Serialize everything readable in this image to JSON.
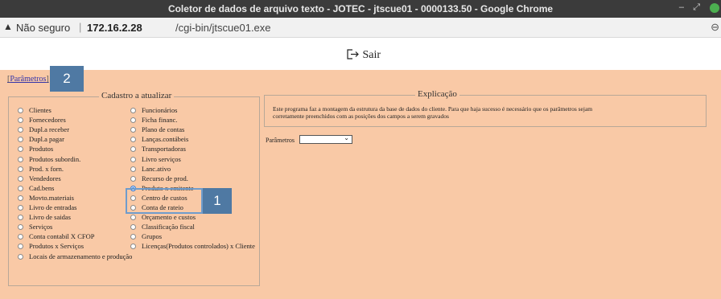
{
  "window": {
    "title": "Coletor de dados de arquivo texto - JOTEC - jtscue01 - 0000133.50 - Google Chrome",
    "controls": [
      "–",
      "⤢"
    ]
  },
  "address_bar": {
    "security_label": "Não seguro",
    "host": "172.16.2.28",
    "path": "/cgi-bin/jtscue01.exe"
  },
  "toolbar": {
    "exit_label": "Sair"
  },
  "parameters_link": "Parâmetros",
  "annotations": {
    "badge_1": "1",
    "badge_2": "2"
  },
  "cadastro": {
    "legend": "Cadastro a atualizar",
    "selected": "Produto x emitente",
    "left_column": [
      "Clientes",
      "Fornecedores",
      "Dupl.a receber",
      "Dupl.a pagar",
      "Produtos",
      "Produtos subordin.",
      "Prod. x forn.",
      "Vendedores",
      "Cad.bens",
      "Movto.materiais",
      "Livro de entradas",
      "Livro de saidas",
      "Serviços",
      "Conta contabil X CFOP",
      "Produtos x Serviços",
      "Locais de armazenamento e produção"
    ],
    "right_column": [
      "Funcionários",
      "Ficha financ.",
      "Plano de contas",
      "Lanças.contábeis",
      "Transportadoras",
      "Livro serviços",
      "Lanc.ativo",
      "Recurso de prod.",
      "Produto x emitente",
      "Centro de custos",
      "Conta de rateio",
      "Orçamento e custos",
      "Classificação fiscal",
      "Grupos",
      "Licenças(Produtos controlados) x Cliente"
    ]
  },
  "explicacao": {
    "legend": "Explicação",
    "text": "Este programa faz a montagem da estrutura da base de dados do cliente. Para que haja sucesso é necessário que os parâmetros sejam corretamente preenchidos com as posições dos campos a serem gravados"
  },
  "parametros_select": {
    "label": "Parâmetros",
    "value": ""
  }
}
